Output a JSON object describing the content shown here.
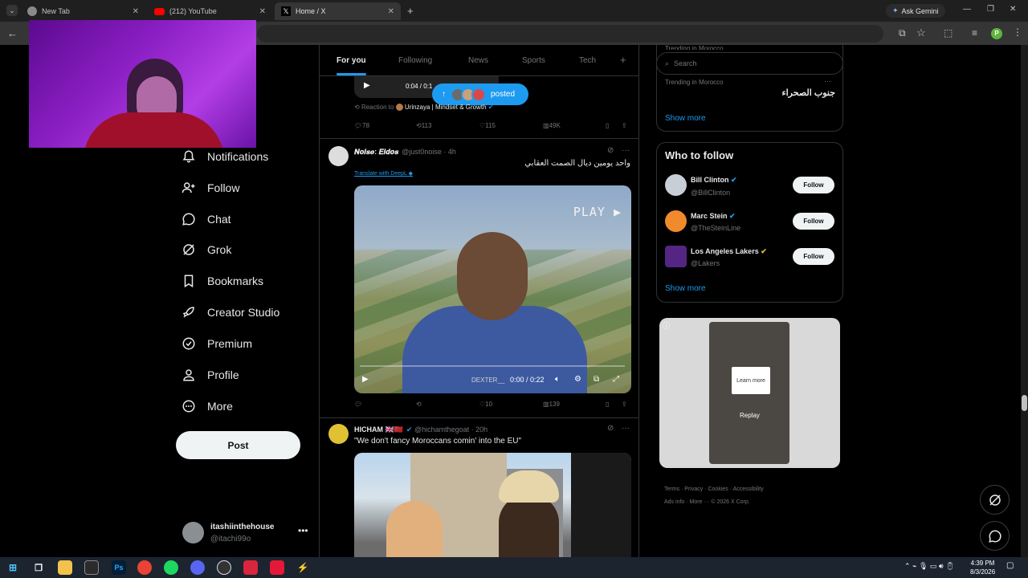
{
  "browser": {
    "tabs": [
      {
        "title": "New Tab",
        "active": false
      },
      {
        "title": "(212) YouTube",
        "active": false
      },
      {
        "title": "Home / X",
        "active": true
      }
    ],
    "ask_gemini": "Ask Gemini",
    "profile_initial": "P"
  },
  "nav": {
    "items": [
      {
        "label": "Notifications",
        "icon": "bell-icon"
      },
      {
        "label": "Follow",
        "icon": "add-person-icon"
      },
      {
        "label": "Chat",
        "icon": "chat-icon"
      },
      {
        "label": "Grok",
        "icon": "grok-icon"
      },
      {
        "label": "Bookmarks",
        "icon": "bookmark-icon"
      },
      {
        "label": "Creator Studio",
        "icon": "rocket-icon"
      },
      {
        "label": "Premium",
        "icon": "verified-icon"
      },
      {
        "label": "Profile",
        "icon": "person-icon"
      },
      {
        "label": "More",
        "icon": "more-circle-icon"
      }
    ],
    "post_label": "Post",
    "account": {
      "name": "itashiinthehouse",
      "handle": "@itachi99o"
    }
  },
  "feed": {
    "tabs": [
      "For you",
      "Following",
      "News",
      "Sports",
      "Tech"
    ],
    "active_tab": "For you",
    "add_tab": "+",
    "posted_pill": "posted",
    "prev_post": {
      "time": "0:04 / 0:1",
      "reaction_prefix": "Reaction to",
      "reaction_target": "Urinzaya | Mindset & Growth",
      "replies": "78",
      "reposts": "113",
      "likes": "115",
      "views": "49K"
    },
    "post1": {
      "name": "𝑵𝒐𝒊𝒔𝒆: 𝑬𝒊𝒅𝒐𝒔",
      "handle": "@just0noise",
      "time": "4h",
      "text": "واحد يومين ديال الصمت العقابي",
      "translate": "Translate with DeepL",
      "video_label": "PLAY",
      "video_watermark": "DEXTER__",
      "video_time": "0:00 / 0:22",
      "replies": "",
      "reposts": "",
      "likes": "10",
      "views": "139"
    },
    "post2": {
      "name": "HICHAM 🇬🇧🇲🇦",
      "handle": "@hichamthegoat",
      "time": "20h",
      "text": "\"We don't fancy Moroccans comin' into the EU\""
    }
  },
  "sidebar": {
    "search_placeholder": "Search",
    "trend_meta": "Trending in Morocco",
    "trend_text": "جنوب الصحراء",
    "trend_top_meta": "Trending in Morocco",
    "show_more": "Show more",
    "who_to_follow": "Who to follow",
    "follow_label": "Follow",
    "suggestions": [
      {
        "name": "Bill Clinton",
        "handle": "@BillClinton",
        "badge": "blue"
      },
      {
        "name": "Marc Stein",
        "handle": "@TheSteinLine",
        "badge": "blue"
      },
      {
        "name": "Los Angeles Lakers",
        "handle": "@Lakers",
        "badge": "gold"
      }
    ],
    "ad": {
      "learn_more": "Learn more",
      "replay": "Replay"
    },
    "footer": [
      "Terms",
      "Privacy",
      "Cookies",
      "Accessibility",
      "Ads info",
      "More ···",
      "© 2026 X Corp."
    ]
  },
  "taskbar": {
    "time": "4:39 PM",
    "date": "8/3/2026",
    "ps_label": "Ps"
  },
  "colors": {
    "accent": "#1d9bf0",
    "gold_badge": "#e8b923",
    "background": "#000000"
  }
}
